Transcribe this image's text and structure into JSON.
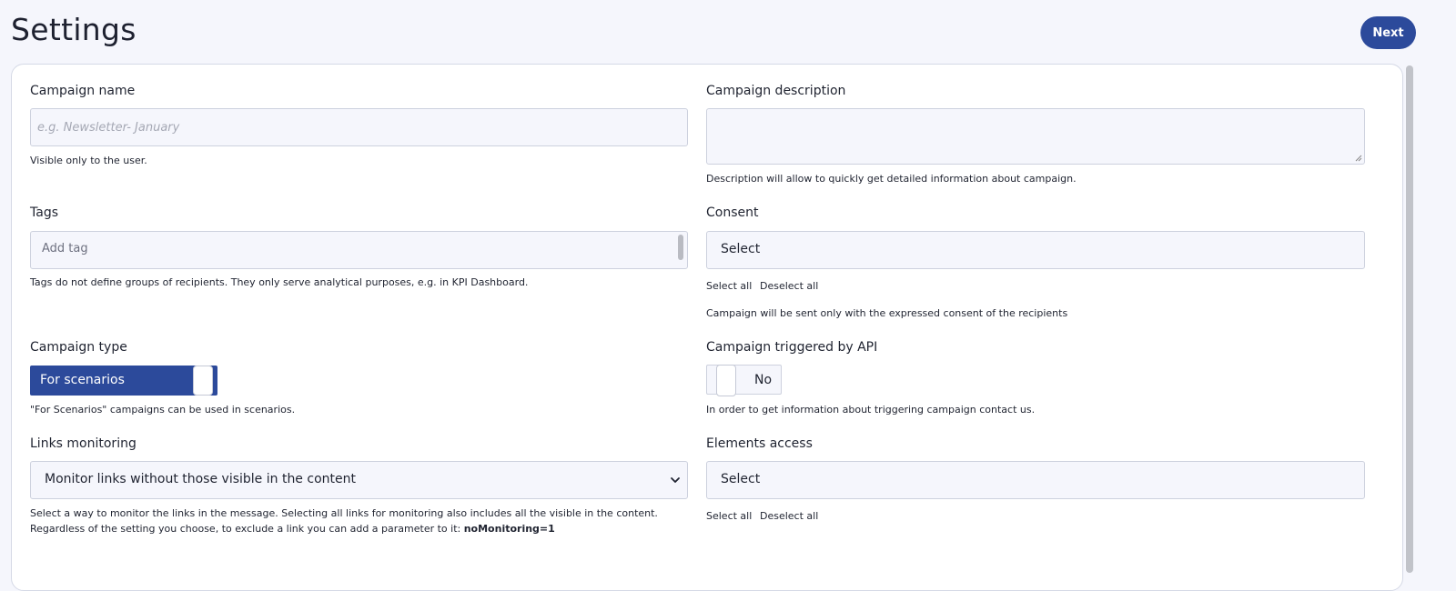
{
  "header": {
    "title": "Settings",
    "next_label": "Next"
  },
  "left": {
    "campaign_name": {
      "label": "Campaign name",
      "placeholder": "e.g. Newsletter- January",
      "help": "Visible only to the user."
    },
    "tags": {
      "label": "Tags",
      "placeholder": "Add tag",
      "help": "Tags do not define groups of recipients. They only serve analytical purposes, e.g. in KPI Dashboard."
    },
    "campaign_type": {
      "label": "Campaign type",
      "value": "For scenarios",
      "help": "\"For Scenarios\" campaigns can be used in scenarios."
    },
    "links_monitoring": {
      "label": "Links monitoring",
      "selected": "Monitor links without those visible in the content",
      "help_line1": "Select a way to monitor the links in the message. Selecting all links for monitoring also includes all the visible in the content.",
      "help_line2": "Regardless of the setting you choose, to exclude a link you can add a parameter to it: ",
      "help_param": "noMonitoring=1"
    }
  },
  "right": {
    "campaign_description": {
      "label": "Campaign description",
      "value": "",
      "help": "Description will allow to quickly get detailed information about campaign."
    },
    "consent": {
      "label": "Consent",
      "selected": "Select",
      "select_all": "Select all",
      "deselect_all": "Deselect all",
      "help": "Campaign will be sent only with the expressed consent of the recipients"
    },
    "api_trigger": {
      "label": "Campaign triggered by API",
      "value": "No",
      "help": "In order to get information about triggering campaign contact us."
    },
    "elements_access": {
      "label": "Elements access",
      "selected": "Select",
      "select_all": "Select all",
      "deselect_all": "Deselect all"
    }
  },
  "colors": {
    "accent": "#2c4a9b",
    "background": "#f5f6fc",
    "card": "#ffffff",
    "border": "#cdd1de"
  }
}
